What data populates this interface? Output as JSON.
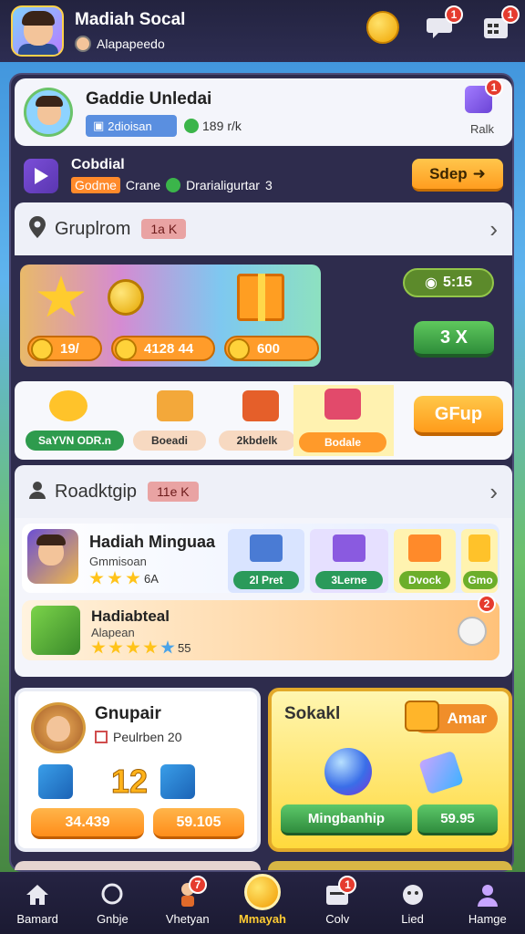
{
  "header": {
    "title": "Madiah Socal",
    "subtitle": "Alapapeedo",
    "badges": {
      "chat": "1",
      "notifications": "1"
    }
  },
  "profile": {
    "name": "Gaddie Unledai",
    "level_chip": "2dioisan",
    "score": "189",
    "score_suffix": "r/k",
    "gem_label": "Ralk",
    "gem_badge": "1"
  },
  "event": {
    "title": "Cobdial",
    "chip": "Godme",
    "text_a": "Crane",
    "text_b": "Drarialigurtar",
    "text_c": "3",
    "button": "Sdep"
  },
  "group_section": {
    "title": "Gruplrom",
    "chip": "1a K"
  },
  "rewards": {
    "pills": [
      "19/",
      "4128 44",
      "600"
    ],
    "timer": "5:15",
    "multiplier": "3 X"
  },
  "tiles": {
    "items": [
      {
        "label": "SaYVN ODR.n"
      },
      {
        "label": "Boeadi"
      },
      {
        "label": "2kbdelk"
      },
      {
        "label": "Bodale"
      }
    ],
    "button": "GFup"
  },
  "ranking_section": {
    "title": "Roadktgip",
    "chip": "11e K"
  },
  "list_item_1": {
    "title": "Hadiah Minguaa",
    "subtitle": "Gmmisoan",
    "meta": "6A",
    "mini_tiles": [
      "2l Pret",
      "3Lerne",
      "Dvock",
      "Gmo"
    ]
  },
  "list_item_2": {
    "title": "Hadiabteal",
    "subtitle": "Alapean",
    "meta": "55",
    "badge": "2"
  },
  "card_left": {
    "title": "Gnupair",
    "subtitle": "Peulrben 20",
    "big_number": "12",
    "pills": [
      "34.439",
      "59.105"
    ]
  },
  "card_right": {
    "title": "Sokakl",
    "amar": "Amar",
    "pill_left": "Mingbanhip",
    "pill_right": "59.95"
  },
  "navbar": {
    "items": [
      {
        "label": "Bamard"
      },
      {
        "label": "Gnbje"
      },
      {
        "label": "Vhetyan",
        "badge": "7"
      },
      {
        "label": "Mmayah"
      },
      {
        "label": "Colv",
        "badge": "1"
      },
      {
        "label": "Lied"
      },
      {
        "label": "Hamge"
      }
    ]
  }
}
